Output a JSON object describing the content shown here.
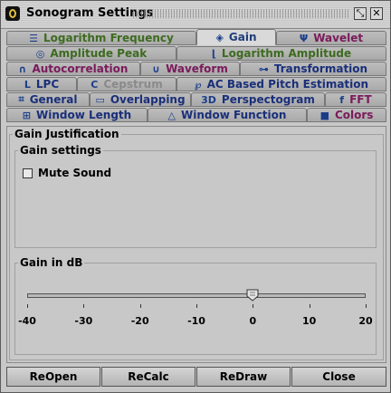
{
  "window": {
    "title": "Sonogram Settings"
  },
  "tabs": [
    {
      "label": "Logarithm Frequency",
      "icon": "bars-icon",
      "glyph": "☰"
    },
    {
      "label": "Gain",
      "icon": "gain-icon",
      "glyph": "◈"
    },
    {
      "label": "Wavelet",
      "icon": "wavelet-icon",
      "glyph": "Ψ"
    },
    {
      "label": "Amplitude Peak",
      "icon": "target-icon",
      "glyph": "◎"
    },
    {
      "label": "Logarithm Amplitude",
      "icon": "log-curve-icon",
      "glyph": "⌊"
    },
    {
      "label": "Autocorrelation",
      "icon": "autocorrelation-icon",
      "glyph": "∩"
    },
    {
      "label": "Waveform",
      "icon": "waveform-icon",
      "glyph": "∪"
    },
    {
      "label": "Transformation",
      "icon": "transform-icon",
      "glyph": "⊶"
    },
    {
      "label": "LPC",
      "icon": "lpc-icon",
      "glyph": "L"
    },
    {
      "label": "Cepstrum",
      "icon": "cepstrum-icon",
      "glyph": "C"
    },
    {
      "label": "AC Based Pitch Estimation",
      "icon": "pitch-icon",
      "glyph": "℘"
    },
    {
      "label": "General",
      "icon": "general-icon",
      "glyph": "⌗"
    },
    {
      "label": "Overlapping",
      "icon": "overlap-icon",
      "glyph": "▭"
    },
    {
      "label": "Perspectogram",
      "icon": "perspectogram-icon",
      "glyph": "3D"
    },
    {
      "label": "FFT",
      "icon": "fft-icon",
      "glyph": "f"
    },
    {
      "label": "Window Length",
      "icon": "window-length-icon",
      "glyph": "⊞"
    },
    {
      "label": "Window Function",
      "icon": "window-function-icon",
      "glyph": "△"
    },
    {
      "label": "Colors",
      "icon": "colors-icon",
      "glyph": "■"
    }
  ],
  "panel": {
    "outer_title": "Gain Justification",
    "settings_title": "Gain settings",
    "mute_label": "Mute Sound",
    "mute_checked": false,
    "slider_title": "Gain in dB",
    "slider": {
      "min": -40,
      "max": 20,
      "value": 0,
      "ticks": [
        "-40",
        "-30",
        "-20",
        "-10",
        "0",
        "10",
        "20"
      ]
    }
  },
  "buttons": {
    "reopen": "ReOpen",
    "recalc": "ReCalc",
    "redraw": "ReDraw",
    "close": "Close"
  }
}
